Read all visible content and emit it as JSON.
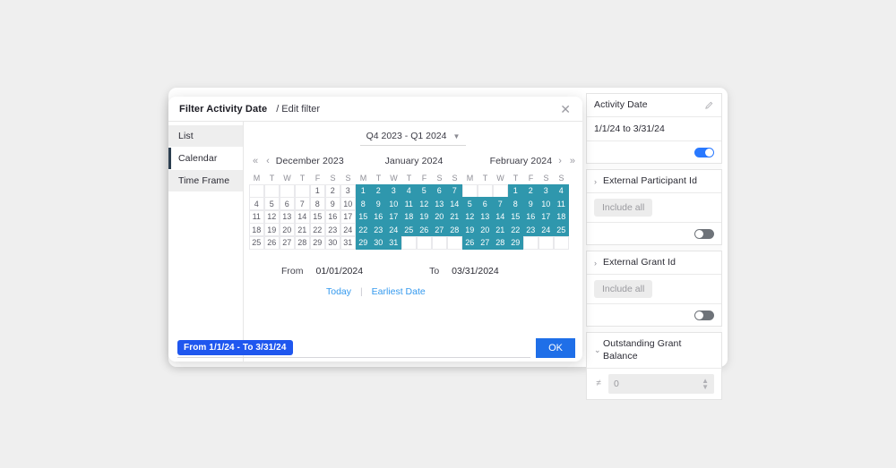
{
  "dialog": {
    "title": "Filter Activity Date",
    "subtitle": "/ Edit filter",
    "close_icon": "close-icon",
    "tabs": [
      {
        "label": "List",
        "active": false
      },
      {
        "label": "Calendar",
        "active": true
      },
      {
        "label": "Time Frame",
        "active": false
      }
    ],
    "quarter_selector": {
      "value": "Q4 2023 - Q1 2024",
      "caret": "⌄"
    },
    "nav": {
      "first": "«",
      "prev": "‹",
      "next": "›",
      "last": "»"
    },
    "months": [
      {
        "label": "December 2023"
      },
      {
        "label": "January 2024"
      },
      {
        "label": "February 2024"
      }
    ],
    "dow": [
      "M",
      "T",
      "W",
      "T",
      "F",
      "S",
      "S"
    ],
    "range": {
      "from_label": "From",
      "from_value": "01/01/2024",
      "to_label": "To",
      "to_value": "03/31/2024"
    },
    "links": {
      "today": "Today",
      "earliest": "Earliest Date",
      "separator": "|"
    },
    "footer": {
      "chip": "From 1/1/24 - To 3/31/24",
      "ok": "OK"
    }
  },
  "calendar_data": {
    "accent": "#2f97ad",
    "months": [
      {
        "name": "December 2023",
        "lead_blanks": 4,
        "days": 31,
        "selected": []
      },
      {
        "name": "January 2024",
        "lead_blanks": 0,
        "days": 31,
        "selected": [
          1,
          2,
          3,
          4,
          5,
          6,
          7,
          8,
          9,
          10,
          11,
          12,
          13,
          14,
          15,
          16,
          17,
          18,
          19,
          20,
          21,
          22,
          23,
          24,
          25,
          26,
          27,
          28,
          29,
          30,
          31
        ]
      },
      {
        "name": "February 2024",
        "lead_blanks": 3,
        "days": 29,
        "selected": [
          1,
          2,
          3,
          4,
          5,
          6,
          7,
          8,
          9,
          10,
          11,
          12,
          13,
          14,
          15,
          16,
          17,
          18,
          19,
          20,
          21,
          22,
          23,
          24,
          25,
          26,
          27,
          28,
          29
        ]
      }
    ]
  },
  "right_panel": {
    "filters": [
      {
        "name": "Activity Date",
        "edit_icon": "pencil-icon",
        "value": "1/1/24 to 3/31/24",
        "toggle": "on",
        "collapsed": false,
        "has_chevron": false,
        "include_all": null
      },
      {
        "name": "External Participant Id",
        "chevron": "›",
        "include_all": "Include all",
        "toggle": "off",
        "collapsed": true
      },
      {
        "name": "External Grant Id",
        "chevron": "›",
        "include_all": "Include all",
        "toggle": "off",
        "collapsed": true
      },
      {
        "name": "Outstanding Grant Balance",
        "chevron": "⌄",
        "operator": "≠",
        "number_value": "0",
        "collapsed": false
      }
    ]
  }
}
